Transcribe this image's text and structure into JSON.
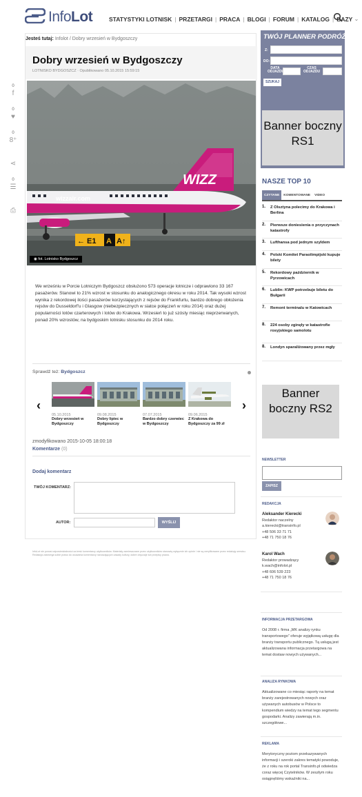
{
  "header": {
    "logo_text_light": "Info",
    "logo_text_bold": "Lot",
    "nav": [
      "STATYSTYKI LOTNISK",
      "PRZETARGI",
      "PRACA",
      "BLOGI",
      "FORUM",
      "KATALOG",
      "BAZY"
    ],
    "nav_more_icon": "chevron-down-icon",
    "search_icon": "search-icon"
  },
  "breadcrumb": {
    "prefix": "Jesteś tutaj:",
    "home": "Infolot",
    "sep": "/",
    "current": "Dobry wrzesień w Bydgoszczy"
  },
  "article": {
    "title": "Dobry wrzesień w Bydgoszczy",
    "meta": "LOTNISKO BYDGOSZCZ · Opublikowano 05.10.2015 15:59:15",
    "photo_caption": "fot. Lotnisko Bydgoszcz",
    "photo_alt": "wizzair.com",
    "body": "We wrześniu w Porcie Lotniczym Bydgoszcz obsłużono 573 operacje lotnicze i odprawiono 33 167 pasażerów. Stanowi to 21% wzrost w stosunku do analogicznego okresu w roku 2014. Tak wysoki wzrost wynika z rekordowej ilości pasażerów korzystających z rejsów do Frankfurtu, bardzo dobrego obłożenia rejsów do Dusseldorf'u i Glasgow (niebezpiecznych w siatce połączeń w roku 2014) oraz dużej popularności lotów czarterowych i lotów do Krakowa. Wrzesień to już szósty miesiąc nieprzerwanych, ponad 20% wzrostów, na bydgoskim lotnisku stosunku do 2014 roku.",
    "share": [
      {
        "icon": "facebook-icon",
        "count": "0",
        "glyph": "f"
      },
      {
        "icon": "twitter-icon",
        "count": "0",
        "glyph": "♥"
      },
      {
        "icon": "google-plus-icon",
        "count": "0",
        "glyph": "8⁺"
      },
      {
        "icon": "share-icon",
        "count": "",
        "glyph": "⋖"
      },
      {
        "icon": "comment-icon",
        "count": "0",
        "glyph": "☰"
      },
      {
        "icon": "print-icon",
        "count": "",
        "glyph": "⎙"
      }
    ]
  },
  "related": {
    "label": "Sprawdź też:",
    "tag": "Bydgoszcz",
    "prev_icon": "chevron-left-icon",
    "next_icon": "chevron-right-icon",
    "items": [
      {
        "date": "05.10.2015",
        "title": "Dobry wrzesień w Bydgoszczy"
      },
      {
        "date": "09.08.2015",
        "title": "Dobry lipiec w Bydgoszczy"
      },
      {
        "date": "07.07.2015",
        "title": "Bardzo dobry czerwiec w Bydgoszczy"
      },
      {
        "date": "09.06.2015",
        "title": "Z Krakowa do Bydgoszczy za 99 zł"
      }
    ]
  },
  "modified": "zmodyfikowano 2015-10-05 18:00:18",
  "comments": {
    "label": "Komentarze",
    "count": "(0)"
  },
  "comment_form": {
    "heading": "Dodaj komentarz",
    "comment_label": "TWÓJ KOMENTARZ:",
    "author_label": "AUTOR:",
    "submit": "WYŚLIJ"
  },
  "fineprint": "InfoLot nie ponosi odpowiedzialności za treść komentarzy użytkowników. Materiały zamieszczane przez użytkowników stanowią wyłącznie ich opinie i nie są weryfikowane przez redakcję serwisu. Redakcja zastrzega sobie prawo do usuwania komentarzy naruszających zasady kultury, dobre obyczaje lub przepisy prawa.",
  "planner": {
    "title": "TWÓJ PLANNER PODRÓŻY",
    "from": "Z:",
    "to": "DO:",
    "date": "DATA ODJAZDU",
    "time": "CZAS ODJAZDU",
    "search": "SZUKAJ"
  },
  "banners": {
    "rs1": "Banner boczny RS1",
    "rs2": "Banner boczny RS2"
  },
  "top10": {
    "title": "NASZE TOP 10",
    "tabs": [
      "CZYTANE",
      "KOMENTOWANE",
      "VIDEO"
    ],
    "items": [
      "Z Olsztyna polecimy do Krakowa i Berlina",
      "Pierwsze doniesienia o przyczynach katastrofy",
      "Lufthansa pod jednym szyldem",
      "Polski Komitet Paraolimpijski kupuje bilety",
      "Rekordowy październik w Pyrzowicach",
      "Lublin: KWP potrzebuje biletu do Bułgarii",
      "Remont terminalu w Katowicach",
      "224 osoby zginęły w katastrofie rosyjskiego samolotu",
      "Londyn sparaliżowany przez mgły"
    ]
  },
  "newsletter": {
    "heading": "NEWSLETTER",
    "button": "ZAPISZ"
  },
  "editors": {
    "heading": "REDAKCJA",
    "people": [
      {
        "name": "Aleksander Kierecki",
        "role": "Redaktor naczelny",
        "email": "a.kierecki@transinfo.pl",
        "tel1": "+48 506 33 71 71",
        "tel2": "+48 71 750 18 76"
      },
      {
        "name": "Karol Wach",
        "role": "Redaktor prowadzący",
        "email": "k.wach@infolot.pl",
        "tel1": "+48 606 539 223",
        "tel2": "+48 71 750 18 76"
      }
    ]
  },
  "side_info": [
    {
      "heading": "INFORMACJA PRZETARGOWA",
      "text": "Od 2008 r. firma „MK analizy rynku transportowego” oferuje wyjątkową usługę dla branży transportu publicznego. Tą usługą jest aktualizowana informacja przetargowa na temat dostaw nowych używanych..."
    },
    {
      "heading": "ANALIZA RYNKOWA",
      "text": "Aktualizowane co miesiąc raporty na temat branży zarejestrowanych nowych oraz używanych autobusów w Polsce to kompendium wiedzy na temat tego segmentu gospodarki. Analizy zawierają m.in. szczegółowe..."
    },
    {
      "heading": "REKLAMA",
      "text": "Merytoryczny poziom przekazywanych informacji i szeroki zakres tematyki powoduje, że z roku na rok portal Transinfo.pl odwiedza coraz więcej Czytelników. W zeszłym roku osiągnęliśmy wskaźniki na..."
    }
  ],
  "colors": {
    "brand": "#4a5a88",
    "planner_bg": "#7b829f",
    "banner_bg": "#d9d9d9"
  }
}
